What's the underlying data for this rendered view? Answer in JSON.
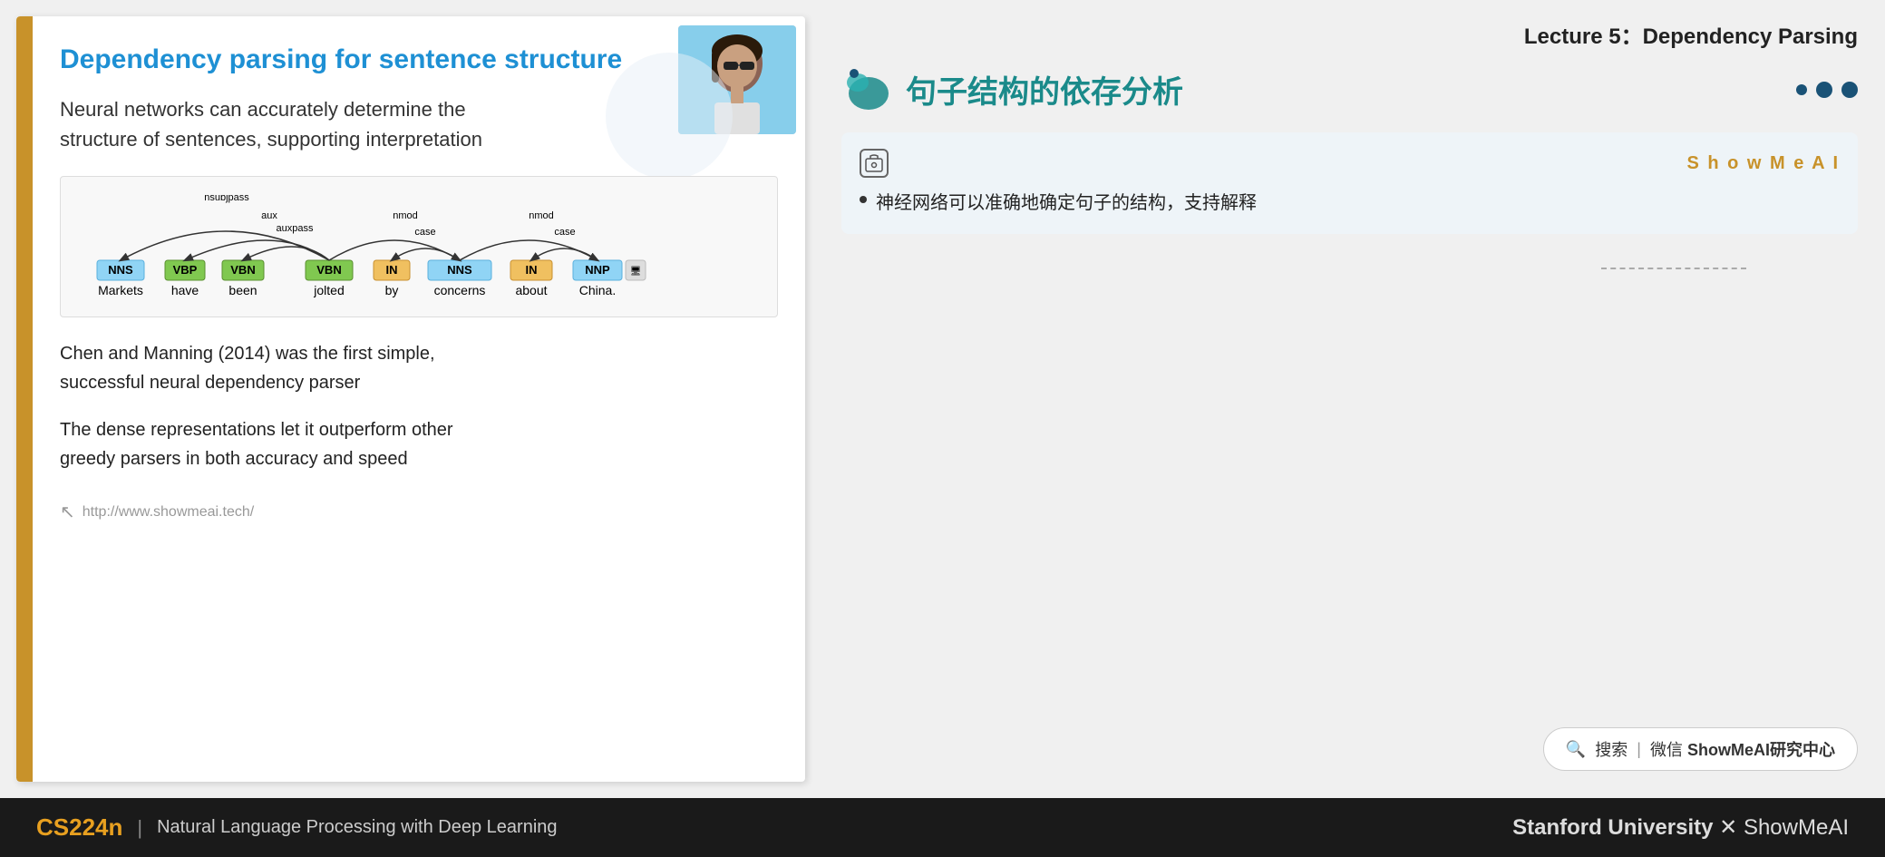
{
  "lecture": {
    "header": "Lecture 5：Dependency Parsing"
  },
  "slide": {
    "title": "Dependency parsing for sentence structure",
    "subtitle": "Neural networks can accurately determine the\nstructure of sentences, supporting interpretation",
    "diagram_words": [
      "Markets",
      "have",
      "been",
      "jolted",
      "by",
      "concerns",
      "about",
      "China."
    ],
    "diagram_tags": [
      "NNS",
      "VBP",
      "VBN",
      "VBN",
      "IN",
      "NNS",
      "IN",
      "NNP"
    ],
    "diagram_relations": [
      "nsubjpass",
      "aux",
      "auxpass",
      "nmod",
      "case",
      "nmod",
      "case"
    ],
    "body1": "Chen and Manning (2014) was the first simple,\nsuccessful neural dependency parser",
    "body2": "The dense representations let it outperform other\ngreedy parsers in both accuracy and speed",
    "footer_url": "http://www.showmeai.tech/"
  },
  "right_panel": {
    "chinese_title": "句子结构的依存分析",
    "dots": [
      "dark",
      "dark",
      "dark"
    ],
    "showmeai_label": "S h o w M e A I",
    "translation_bullet": "神经网络可以准确地确定句子的结构，支持解释"
  },
  "search": {
    "icon": "🔍",
    "text": "搜索 | 微信 ShowMeAI研究中心"
  },
  "bottom_bar": {
    "course": "CS224n",
    "pipe": "|",
    "description": "Natural Language Processing with Deep Learning",
    "right": "Stanford University  ✕  ShowMeAI"
  }
}
